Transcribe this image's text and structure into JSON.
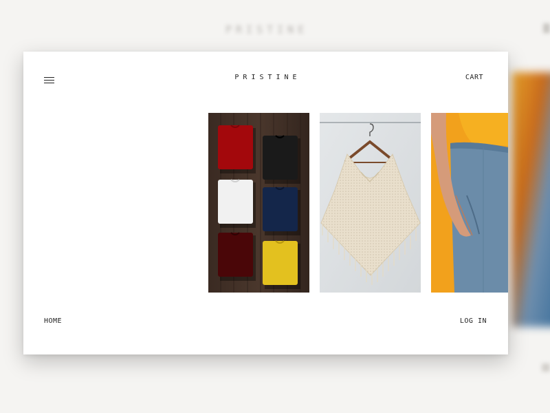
{
  "backdrop": {
    "brand": "PRISTINE"
  },
  "header": {
    "menu_icon": "hamburger-menu-icon",
    "brand": "PRISTINE",
    "cart_label": "CART"
  },
  "footer": {
    "home_label": "HOME",
    "login_label": "LOG IN"
  },
  "products": [
    {
      "image": "folded-tshirts-on-wood-photo",
      "colors": [
        "#a3080c",
        "#1a1a1a",
        "#f1f1f1",
        "#14264a",
        "#4a0608",
        "#e3c11f"
      ]
    },
    {
      "image": "knit-poncho-on-hanger-photo",
      "colors": [
        "#dfe2e4",
        "#e9dfcc"
      ]
    },
    {
      "image": "person-in-orange-top-and-blue-trousers-photo",
      "colors": [
        "#f2a11c",
        "#6b8ca9"
      ]
    }
  ]
}
